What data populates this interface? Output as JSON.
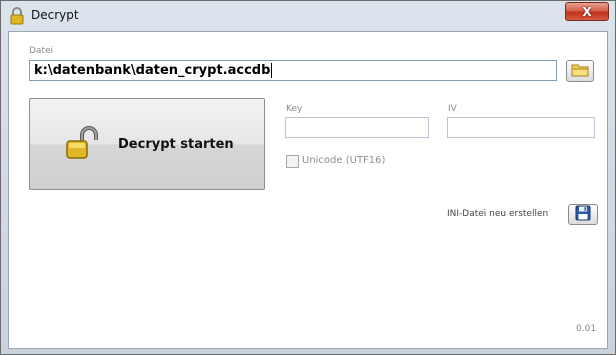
{
  "window": {
    "title": "Decrypt",
    "close_label": "X"
  },
  "file": {
    "label": "Datei",
    "value": "k:\\datenbank\\daten_crypt.accdb"
  },
  "decrypt_button": {
    "label": "Decrypt starten"
  },
  "key": {
    "label": "Key",
    "value": ""
  },
  "iv": {
    "label": "IV",
    "value": ""
  },
  "unicode_checkbox": {
    "label": "Unicode (UTF16)",
    "checked": false
  },
  "ini": {
    "label": "INI-Datei neu erstellen"
  },
  "version": "0.01",
  "icons": {
    "title": "lock-icon",
    "folder": "folder-icon",
    "decrypt": "padlock-open-icon",
    "save": "floppy-disk-icon"
  },
  "colors": {
    "close_button": "#c0321c",
    "lock_gold": "#e2b624",
    "floppy_blue": "#2a5ca8"
  }
}
